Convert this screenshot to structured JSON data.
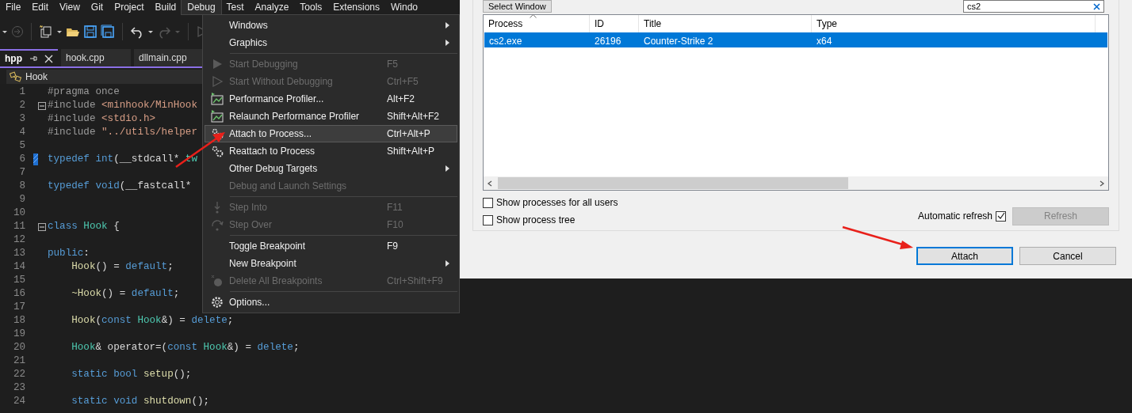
{
  "menubar": [
    {
      "label": "File",
      "selected": false
    },
    {
      "label": "Edit",
      "selected": false
    },
    {
      "label": "View",
      "selected": false
    },
    {
      "label": "Git",
      "selected": false
    },
    {
      "label": "Project",
      "selected": false
    },
    {
      "label": "Build",
      "selected": false
    },
    {
      "label": "Debug",
      "selected": true
    },
    {
      "label": "Test",
      "selected": false
    },
    {
      "label": "Analyze",
      "selected": false
    },
    {
      "label": "Tools",
      "selected": false
    },
    {
      "label": "Extensions",
      "selected": false
    },
    {
      "label": "Windo",
      "selected": false
    }
  ],
  "tabs": [
    {
      "label": "hpp",
      "selected": true,
      "pinned": true
    },
    {
      "label": "hook.cpp",
      "selected": false,
      "pinned": false
    },
    {
      "label": "dllmain.cpp",
      "selected": false,
      "pinned": false
    }
  ],
  "breadcrumb": "Hook",
  "code_lines": [
    {
      "number": "1",
      "fold": false,
      "changed": false,
      "tokens": [
        {
          "kind": "pp",
          "text": "#pragma once"
        }
      ]
    },
    {
      "number": "2",
      "fold": true,
      "changed": false,
      "tokens": [
        {
          "kind": "pp",
          "text": "#include "
        },
        {
          "kind": "str",
          "text": "<minhook/MinHook"
        }
      ]
    },
    {
      "number": "3",
      "fold": false,
      "changed": false,
      "tokens": [
        {
          "kind": "pp",
          "text": "#include "
        },
        {
          "kind": "str",
          "text": "<stdio.h>"
        }
      ]
    },
    {
      "number": "4",
      "fold": false,
      "changed": false,
      "tokens": [
        {
          "kind": "pp",
          "text": "#include "
        },
        {
          "kind": "str",
          "text": "\"../utils/helper"
        }
      ]
    },
    {
      "number": "5",
      "fold": false,
      "changed": false
    },
    {
      "number": "6",
      "fold": false,
      "changed": true,
      "tokens": [
        {
          "kind": "kw",
          "text": "typedef int"
        },
        {
          "kind": "plain",
          "text": "(__stdcall* "
        },
        {
          "kind": "type",
          "text": "tw"
        }
      ]
    },
    {
      "number": "7",
      "fold": false,
      "changed": false
    },
    {
      "number": "8",
      "fold": false,
      "changed": false,
      "tokens": [
        {
          "kind": "kw",
          "text": "typedef void"
        },
        {
          "kind": "plain",
          "text": "(__fastcall*"
        }
      ]
    },
    {
      "number": "9",
      "fold": false,
      "changed": false
    },
    {
      "number": "10",
      "fold": false,
      "changed": false
    },
    {
      "number": "11",
      "fold": true,
      "changed": false,
      "tokens": [
        {
          "kind": "kw",
          "text": "class"
        },
        {
          "kind": "type",
          "text": " Hook"
        },
        {
          "kind": "plain",
          "text": " {"
        }
      ]
    },
    {
      "number": "12",
      "fold": false,
      "changed": false
    },
    {
      "number": "13",
      "fold": false,
      "changed": false,
      "tokens": [
        {
          "kind": "kw",
          "text": "public"
        },
        {
          "kind": "plain",
          "text": ":"
        }
      ]
    },
    {
      "number": "14",
      "fold": false,
      "changed": false,
      "tokens": [
        {
          "kind": "fn",
          "text": "    Hook"
        },
        {
          "kind": "plain",
          "text": "() = "
        },
        {
          "kind": "kw",
          "text": "default"
        },
        {
          "kind": "plain",
          "text": ";"
        }
      ]
    },
    {
      "number": "15",
      "fold": false,
      "changed": false
    },
    {
      "number": "16",
      "fold": false,
      "changed": false,
      "tokens": [
        {
          "kind": "fn",
          "text": "    ~Hook"
        },
        {
          "kind": "plain",
          "text": "() = "
        },
        {
          "kind": "kw",
          "text": "default"
        },
        {
          "kind": "plain",
          "text": ";"
        }
      ]
    },
    {
      "number": "17",
      "fold": false,
      "changed": false
    },
    {
      "number": "18",
      "fold": false,
      "changed": false,
      "tokens": [
        {
          "kind": "fn",
          "text": "    Hook"
        },
        {
          "kind": "plain",
          "text": "("
        },
        {
          "kind": "kw",
          "text": "const"
        },
        {
          "kind": "type",
          "text": " Hook"
        },
        {
          "kind": "plain",
          "text": "&) = "
        },
        {
          "kind": "kw",
          "text": "delete"
        },
        {
          "kind": "plain",
          "text": ";"
        }
      ]
    },
    {
      "number": "19",
      "fold": false,
      "changed": false
    },
    {
      "number": "20",
      "fold": false,
      "changed": false,
      "tokens": [
        {
          "kind": "type",
          "text": "    Hook"
        },
        {
          "kind": "plain",
          "text": "& operator=("
        },
        {
          "kind": "kw",
          "text": "const"
        },
        {
          "kind": "type",
          "text": " Hook"
        },
        {
          "kind": "plain",
          "text": "&) = "
        },
        {
          "kind": "kw",
          "text": "delete"
        },
        {
          "kind": "plain",
          "text": ";"
        }
      ]
    },
    {
      "number": "21",
      "fold": false,
      "changed": false
    },
    {
      "number": "22",
      "fold": false,
      "changed": false,
      "tokens": [
        {
          "kind": "kw",
          "text": "    static bool"
        },
        {
          "kind": "fn",
          "text": " setup"
        },
        {
          "kind": "plain",
          "text": "();"
        }
      ]
    },
    {
      "number": "23",
      "fold": false,
      "changed": false
    },
    {
      "number": "24",
      "fold": false,
      "changed": false,
      "tokens": [
        {
          "kind": "kw",
          "text": "    static void"
        },
        {
          "kind": "fn",
          "text": " shutdown"
        },
        {
          "kind": "plain",
          "text": "();"
        }
      ]
    }
  ],
  "debug_menu": [
    {
      "kind": "item",
      "label": "Windows",
      "submenu": true,
      "disabled": false,
      "selected": false
    },
    {
      "kind": "item",
      "label": "Graphics",
      "submenu": true,
      "disabled": false,
      "selected": false
    },
    {
      "kind": "separator"
    },
    {
      "kind": "item",
      "label": "Start Debugging",
      "shortcut": "F5",
      "submenu": false,
      "disabled": true,
      "selected": false
    },
    {
      "kind": "item",
      "label": "Start Without Debugging",
      "shortcut": "Ctrl+F5",
      "submenu": false,
      "disabled": true,
      "selected": false
    },
    {
      "kind": "item",
      "label": "Performance Profiler...",
      "shortcut": "Alt+F2",
      "submenu": false,
      "disabled": false,
      "selected": false
    },
    {
      "kind": "item",
      "label": "Relaunch Performance Profiler",
      "shortcut": "Shift+Alt+F2",
      "submenu": false,
      "disabled": false,
      "selected": false
    },
    {
      "kind": "item",
      "label": "Attach to Process...",
      "shortcut": "Ctrl+Alt+P",
      "submenu": false,
      "disabled": false,
      "selected": true
    },
    {
      "kind": "item",
      "label": "Reattach to Process",
      "shortcut": "Shift+Alt+P",
      "submenu": false,
      "disabled": false,
      "selected": false
    },
    {
      "kind": "item",
      "label": "Other Debug Targets",
      "submenu": true,
      "disabled": false,
      "selected": false
    },
    {
      "kind": "item",
      "label": "Debug and Launch Settings",
      "submenu": false,
      "disabled": true,
      "selected": false
    },
    {
      "kind": "separator"
    },
    {
      "kind": "item",
      "label": "Step Into",
      "shortcut": "F11",
      "submenu": false,
      "disabled": true,
      "selected": false
    },
    {
      "kind": "item",
      "label": "Step Over",
      "shortcut": "F10",
      "submenu": false,
      "disabled": true,
      "selected": false
    },
    {
      "kind": "separator"
    },
    {
      "kind": "item",
      "label": "Toggle Breakpoint",
      "shortcut": "F9",
      "submenu": false,
      "disabled": false,
      "selected": false
    },
    {
      "kind": "item",
      "label": "New Breakpoint",
      "submenu": true,
      "disabled": false,
      "selected": false
    },
    {
      "kind": "item",
      "label": "Delete All Breakpoints",
      "shortcut": "Ctrl+Shift+F9",
      "submenu": false,
      "disabled": true,
      "selected": false
    },
    {
      "kind": "separator"
    },
    {
      "kind": "item",
      "label": "Options...",
      "submenu": false,
      "disabled": false,
      "selected": false
    }
  ],
  "dialog": {
    "select_window_button": "Select Window",
    "search": {
      "value": "cs2"
    },
    "columns": [
      {
        "label": "Process",
        "sorted": true
      },
      {
        "label": "ID",
        "sorted": false
      },
      {
        "label": "Title",
        "sorted": false
      },
      {
        "label": "Type",
        "sorted": false
      }
    ],
    "rows": [
      {
        "cells": [
          "cs2.exe",
          "26196",
          "Counter-Strike 2",
          "x64"
        ],
        "selected": true
      }
    ],
    "options": [
      {
        "label": "Show processes for all users",
        "checked": false
      },
      {
        "label": "Show process tree",
        "checked": false
      }
    ],
    "auto_refresh": {
      "label": "Automatic refresh",
      "checked": true
    },
    "refresh_button": {
      "label": "Refresh",
      "disabled": true
    },
    "buttons": [
      {
        "label": "Attach",
        "default": true
      },
      {
        "label": "Cancel",
        "default": false
      }
    ]
  }
}
